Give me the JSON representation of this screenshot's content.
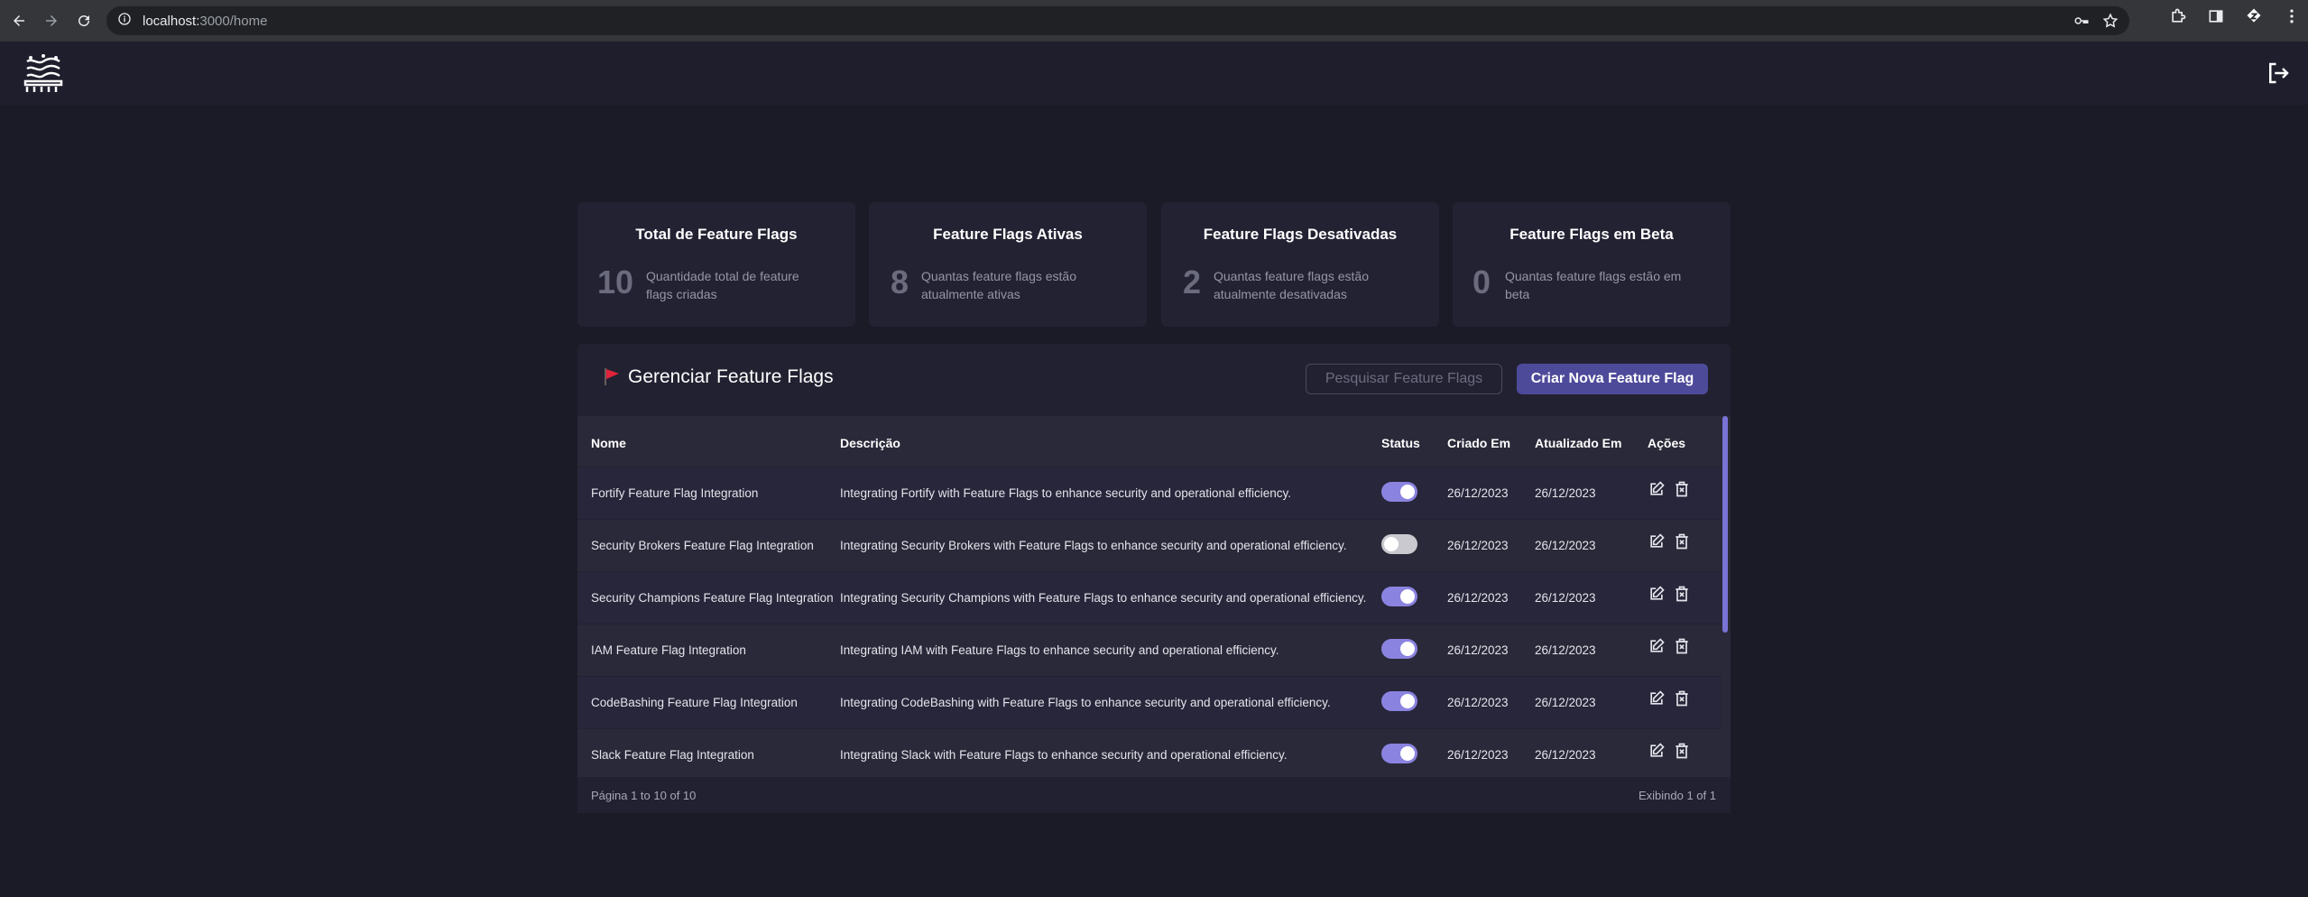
{
  "browser": {
    "url_host": "localhost:",
    "url_port_path": "3000/home"
  },
  "stats": [
    {
      "title": "Total de Feature Flags",
      "value": "10",
      "description_line1": "Quantidade total de feature",
      "description_line2": "flags criadas"
    },
    {
      "title": "Feature Flags Ativas",
      "value": "8",
      "description_line1": "Quantas feature flags estão",
      "description_line2": "atualmente ativas"
    },
    {
      "title": "Feature Flags Desativadas",
      "value": "2",
      "description_line1": "Quantas feature flags estão",
      "description_line2": "atualmente desativadas"
    },
    {
      "title": "Feature Flags em Beta",
      "value": "0",
      "description_line1": "Quantas feature flags estão em",
      "description_line2": "beta"
    }
  ],
  "panel": {
    "title": "Gerenciar Feature Flags",
    "search_placeholder": "Pesquisar Feature Flags",
    "create_label": "Criar Nova Feature Flag"
  },
  "table": {
    "headers": {
      "name": "Nome",
      "description": "Descrição",
      "status": "Status",
      "created": "Criado Em",
      "updated": "Atualizado Em",
      "actions": "Ações"
    },
    "rows": [
      {
        "name": "Fortify Feature Flag Integration",
        "description": "Integrating Fortify with Feature Flags to enhance security and operational efficiency.",
        "status": "on",
        "created": "26/12/2023",
        "updated": "26/12/2023"
      },
      {
        "name": "Security Brokers Feature Flag Integration",
        "description": "Integrating Security Brokers with Feature Flags to enhance security and operational efficiency.",
        "status": "off",
        "created": "26/12/2023",
        "updated": "26/12/2023"
      },
      {
        "name": "Security Champions Feature Flag Integration",
        "description": "Integrating Security Champions with Feature Flags to enhance security and operational efficiency.",
        "status": "on",
        "created": "26/12/2023",
        "updated": "26/12/2023"
      },
      {
        "name": "IAM Feature Flag Integration",
        "description": "Integrating IAM with Feature Flags to enhance security and operational efficiency.",
        "status": "on",
        "created": "26/12/2023",
        "updated": "26/12/2023"
      },
      {
        "name": "CodeBashing Feature Flag Integration",
        "description": "Integrating CodeBashing with Feature Flags to enhance security and operational efficiency.",
        "status": "on",
        "created": "26/12/2023",
        "updated": "26/12/2023"
      },
      {
        "name": "Slack Feature Flag Integration",
        "description": "Integrating Slack with Feature Flags to enhance security and operational efficiency.",
        "status": "on",
        "created": "26/12/2023",
        "updated": "26/12/2023"
      }
    ]
  },
  "footer": {
    "pagination": "Página 1 to 10 of 10",
    "showing": "Exibindo 1 of 1"
  },
  "colors": {
    "accent": "#4e4a9a",
    "toggle_on": "#8b83e0",
    "toggle_off": "#c9c9cf",
    "flag_red": "#e0233a"
  }
}
